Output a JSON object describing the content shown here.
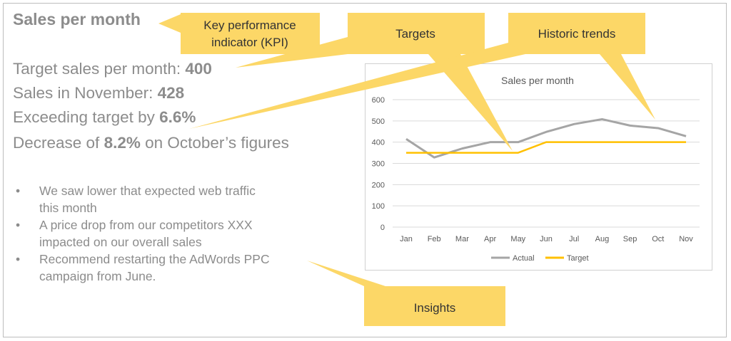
{
  "slide": {
    "title": "Sales per month",
    "kpis": [
      {
        "label": "Target sales per month: ",
        "value": "400",
        "suffix": ""
      },
      {
        "label": "Sales in November: ",
        "value": "428",
        "suffix": ""
      },
      {
        "label": "Exceeding target by ",
        "value": "6.6%",
        "suffix": ""
      },
      {
        "label": "Decrease of ",
        "value": "8.2%",
        "suffix": " on October’s figures"
      }
    ],
    "insights": [
      {
        "line1": "We saw lower that expected web traffic",
        "line2": "this month"
      },
      {
        "line1": "A price drop from our competitors XXX",
        "line2": "impacted on our overall sales"
      },
      {
        "line1": "Recommend restarting the AdWords PPC",
        "line2": "campaign from June."
      }
    ],
    "bullet_glyph": "•"
  },
  "callouts": {
    "kpi": {
      "line1": "Key performance",
      "line2": "indicator (KPI)"
    },
    "targets": "Targets",
    "historic": "Historic trends",
    "insights": "Insights",
    "color": "#fcd767"
  },
  "chart_data": {
    "type": "line",
    "title": "Sales per month",
    "categories": [
      "Jan",
      "Feb",
      "Mar",
      "Apr",
      "May",
      "Jun",
      "Jul",
      "Aug",
      "Sep",
      "Oct",
      "Nov"
    ],
    "series": [
      {
        "name": "Actual",
        "color": "#a5a5a5",
        "values": [
          415,
          328,
          370,
          400,
          400,
          448,
          485,
          508,
          478,
          466,
          428
        ]
      },
      {
        "name": "Target",
        "color": "#ffc000",
        "values": [
          350,
          350,
          350,
          350,
          350,
          400,
          400,
          400,
          400,
          400,
          400
        ]
      }
    ],
    "yticks": [
      0,
      100,
      200,
      300,
      400,
      500,
      600
    ],
    "ylim": [
      0,
      600
    ],
    "grid": true,
    "legend": "bottom"
  }
}
